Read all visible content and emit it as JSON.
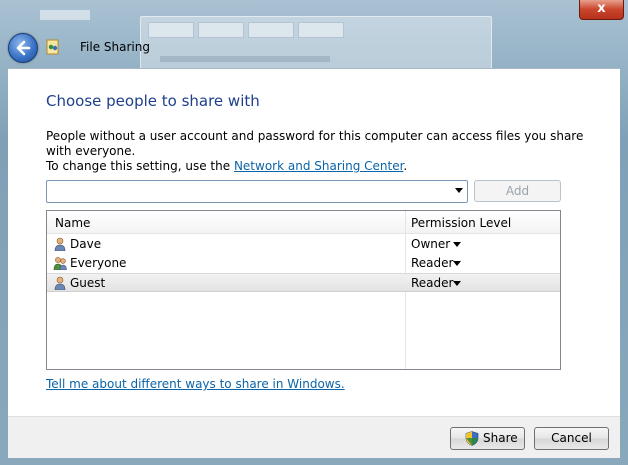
{
  "window": {
    "title": "File Sharing",
    "close_label": "x",
    "back_icon": "back-arrow-icon",
    "app_icon": "file-sharing-icon"
  },
  "dialog": {
    "heading": "Choose people to share with",
    "description_line1": "People without a user account and password for this computer can access files you share with everyone.",
    "description_line2_prefix": "To change this setting, use the ",
    "description_link": "Network and Sharing Center",
    "description_line2_suffix": ".",
    "combo_value": "",
    "add_label": "Add"
  },
  "list": {
    "columns": [
      "Name",
      "Permission Level"
    ],
    "rows": [
      {
        "name": "Dave",
        "permission": "Owner",
        "icon": "user-icon",
        "selected": false
      },
      {
        "name": "Everyone",
        "permission": "Reader",
        "icon": "group-icon",
        "selected": false
      },
      {
        "name": "Guest",
        "permission": "Reader",
        "icon": "user-icon",
        "selected": true
      }
    ]
  },
  "help_link": "Tell me about different ways to share in Windows.",
  "footer": {
    "share_label": "Share",
    "cancel_label": "Cancel",
    "share_icon": "uac-shield-icon"
  },
  "colors": {
    "heading": "#1e3f8a",
    "link": "#0b64a8"
  }
}
